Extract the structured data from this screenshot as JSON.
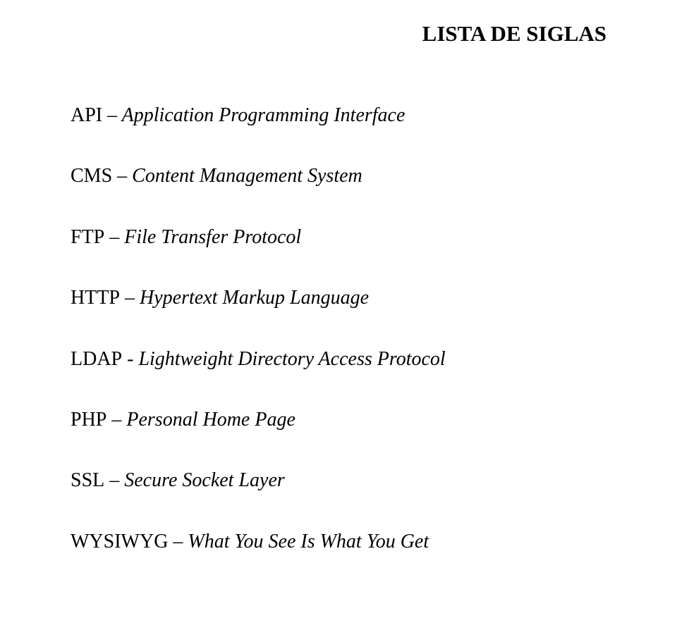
{
  "title": "LISTA DE SIGLAS",
  "entries": [
    {
      "acronym": "API",
      "sep": " – ",
      "expansion": "Application Programming Interface"
    },
    {
      "acronym": "CMS",
      "sep": " – ",
      "expansion": "Content Management System"
    },
    {
      "acronym": "FTP",
      "sep": " – ",
      "expansion": "File Transfer Protocol"
    },
    {
      "acronym": "HTTP",
      "sep": " – ",
      "expansion": "Hypertext Markup Language"
    },
    {
      "acronym": "LDAP",
      "sep": " - ",
      "expansion": "Lightweight Directory Access Protocol"
    },
    {
      "acronym": "PHP",
      "sep": " – ",
      "expansion": "Personal Home Page"
    },
    {
      "acronym": "SSL",
      "sep": " – ",
      "expansion": "Secure Socket Layer"
    },
    {
      "acronym": "WYSIWYG",
      "sep": " – ",
      "expansion": "What You See Is What You Get"
    }
  ]
}
